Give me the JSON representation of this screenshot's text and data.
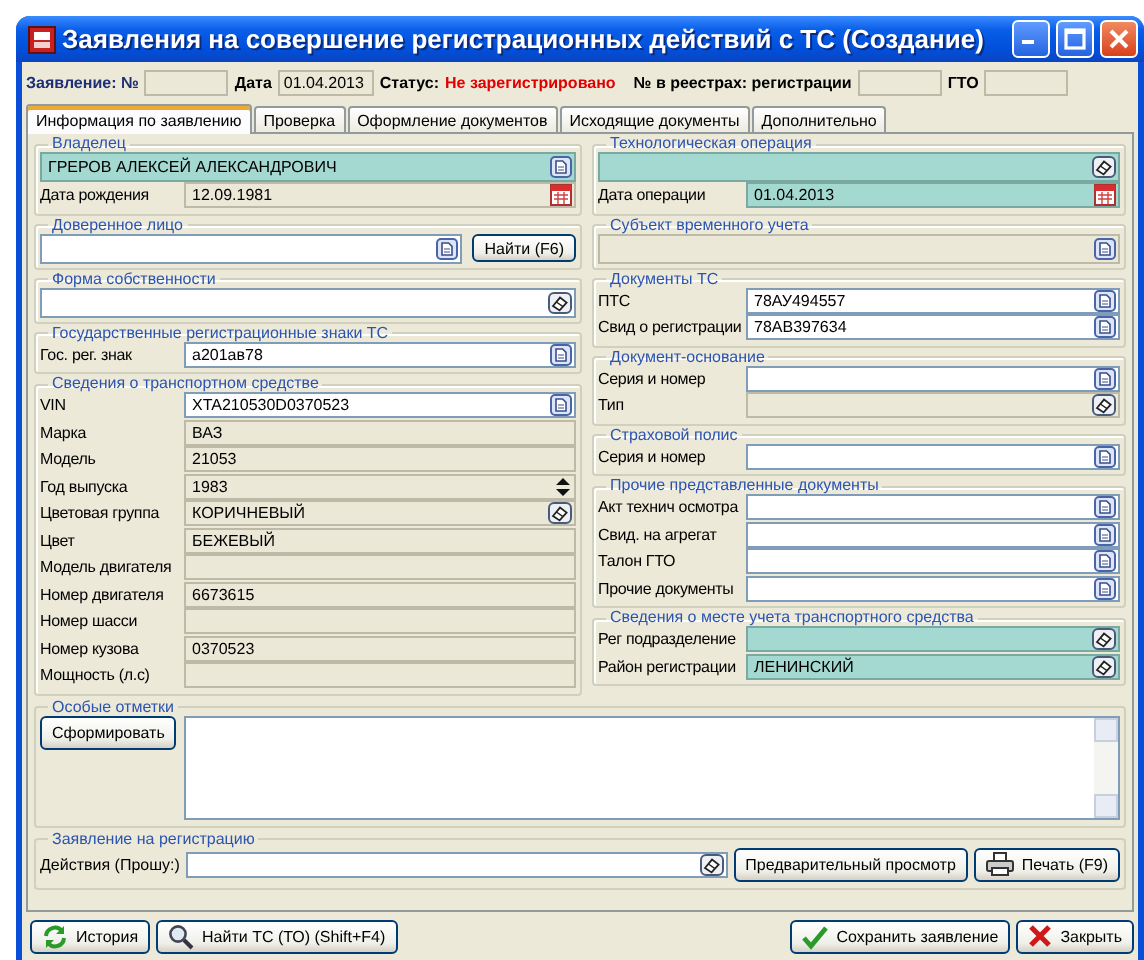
{
  "window": {
    "title": "Заявления на совершение регистрационных действий с ТС (Создание)"
  },
  "header": [
    {
      "kind": "caption",
      "text": "Заявление: №"
    },
    {
      "kind": "box"
    },
    {
      "kind": "label",
      "text": "Дата"
    },
    {
      "kind": "box",
      "value": "01.04.2013"
    },
    {
      "kind": "label",
      "text": "Статус:"
    },
    {
      "kind": "status",
      "text": "Не зарегистрировано"
    },
    {
      "kind": "label",
      "text": "№ в реестрах: регистрации"
    },
    {
      "kind": "box"
    },
    {
      "kind": "label",
      "text": "ГТО"
    },
    {
      "kind": "box"
    }
  ],
  "tabs": [
    {
      "label": "Информация по заявлению",
      "selected": true
    },
    {
      "label": "Проверка",
      "selected": false
    },
    {
      "label": "Оформление документов",
      "selected": false
    },
    {
      "label": "Исходящие документы",
      "selected": false
    },
    {
      "label": "Дополнительно",
      "selected": false
    }
  ],
  "left_groups": [
    {
      "title": "Владелец",
      "rows": [
        {
          "kind": "lookup",
          "value": "ГРЕРОВ АЛЕКСЕЙ АЛЕКСАНДРОВИЧ",
          "required": true,
          "disabled": false
        },
        {
          "kind": "date",
          "label": "Дата рождения",
          "value": "12.09.1981",
          "required": false,
          "disabled": true
        }
      ]
    },
    {
      "title": "Доверенное лицо",
      "rows": [
        {
          "kind": "lookup",
          "required": false,
          "disabled": false,
          "button": "Найти (F6)"
        }
      ]
    },
    {
      "title": "Форма собственности",
      "rows": [
        {
          "kind": "select",
          "required": false,
          "disabled": false
        }
      ]
    },
    {
      "title": "Государственные регистрационные знаки ТС",
      "rows": [
        {
          "kind": "lookup",
          "label": "Гос. рег. знак",
          "value": "а201ав78",
          "required": false,
          "disabled": false
        }
      ]
    },
    {
      "title": "Сведения о транспортном средстве",
      "rows": [
        {
          "kind": "lookup",
          "label": "VIN",
          "value": "XTA210530D0370523",
          "required": false,
          "disabled": false
        },
        {
          "kind": "text",
          "label": "Марка",
          "value": "ВАЗ",
          "required": false,
          "disabled": true
        },
        {
          "kind": "text",
          "label": "Модель",
          "value": "21053",
          "required": false,
          "disabled": true
        },
        {
          "kind": "number",
          "label": "Год выпуска",
          "value": "1983",
          "required": false,
          "disabled": true
        },
        {
          "kind": "select",
          "label": "Цветовая группа",
          "value": "КОРИЧНЕВЫЙ",
          "required": false,
          "disabled": true
        },
        {
          "kind": "text",
          "label": "Цвет",
          "value": "БЕЖЕВЫЙ",
          "required": false,
          "disabled": true
        },
        {
          "kind": "text",
          "label": "Модель двигателя",
          "required": false,
          "disabled": true
        },
        {
          "kind": "text",
          "label": "Номер двигателя",
          "value": "6673615",
          "required": false,
          "disabled": true
        },
        {
          "kind": "text",
          "label": "Номер шасси",
          "required": false,
          "disabled": true
        },
        {
          "kind": "text",
          "label": "Номер кузова",
          "value": "0370523",
          "required": false,
          "disabled": true
        },
        {
          "kind": "text",
          "label": "Мощность (л.с)",
          "required": false,
          "disabled": true
        }
      ]
    }
  ],
  "right_groups": [
    {
      "title": "Технологическая операция",
      "rows": [
        {
          "kind": "select",
          "required": true,
          "disabled": false
        },
        {
          "kind": "date",
          "label": "Дата операции",
          "value": "01.04.2013",
          "required": true,
          "disabled": false
        }
      ]
    },
    {
      "title": "Субъект временного учета",
      "rows": [
        {
          "kind": "lookup",
          "required": false,
          "disabled": true
        }
      ]
    },
    {
      "title": "Документы ТС",
      "rows": [
        {
          "kind": "lookup",
          "label": "ПТС",
          "value": "78АУ494557",
          "required": false,
          "disabled": false
        },
        {
          "kind": "lookup",
          "label": "Свид о регистрации",
          "value": "78АВ397634",
          "required": false,
          "disabled": false
        }
      ]
    },
    {
      "title": "Документ-основание",
      "rows": [
        {
          "kind": "lookup",
          "label": "Серия и номер",
          "required": false,
          "disabled": false
        },
        {
          "kind": "select",
          "label": "Тип",
          "required": false,
          "disabled": true
        }
      ]
    },
    {
      "title": "Страховой полис",
      "rows": [
        {
          "kind": "lookup",
          "label": "Серия и номер",
          "required": false,
          "disabled": false
        }
      ]
    },
    {
      "title": "Прочие представленные документы",
      "rows": [
        {
          "kind": "lookup",
          "label": "Акт технич осмотра",
          "required": false,
          "disabled": false
        },
        {
          "kind": "lookup",
          "label": "Свид. на агрегат",
          "required": false,
          "disabled": false
        },
        {
          "kind": "lookup",
          "label": "Талон ГТО",
          "required": false,
          "disabled": false
        },
        {
          "kind": "lookup",
          "label": "Прочие документы",
          "required": false,
          "disabled": false
        }
      ]
    },
    {
      "title": "Сведения о месте учета транспортного средства",
      "rows": [
        {
          "kind": "select",
          "label": "Рег подразделение",
          "required": true,
          "disabled": false
        },
        {
          "kind": "select",
          "label": "Район регистрации",
          "value": "ЛЕНИНСКИЙ",
          "required": true,
          "disabled": false
        }
      ]
    }
  ],
  "remarks": {
    "title": "Особые отметки",
    "button": "Сформировать"
  },
  "application": {
    "title": "Заявление на регистрацию",
    "label": "Действия (Прошу:)",
    "kind": "select",
    "buttons": [
      {
        "kind": "preview",
        "label": "Предварительный просмотр"
      },
      {
        "kind": "print",
        "label": "Печать (F9)"
      }
    ]
  },
  "footer": {
    "left": [
      {
        "kind": "history",
        "label": "История"
      },
      {
        "kind": "find",
        "label": "Найти ТС (ТО) (Shift+F4)"
      }
    ],
    "right": [
      {
        "kind": "save",
        "label": "Сохранить заявление"
      },
      {
        "kind": "close",
        "label": "Закрыть"
      }
    ]
  }
}
